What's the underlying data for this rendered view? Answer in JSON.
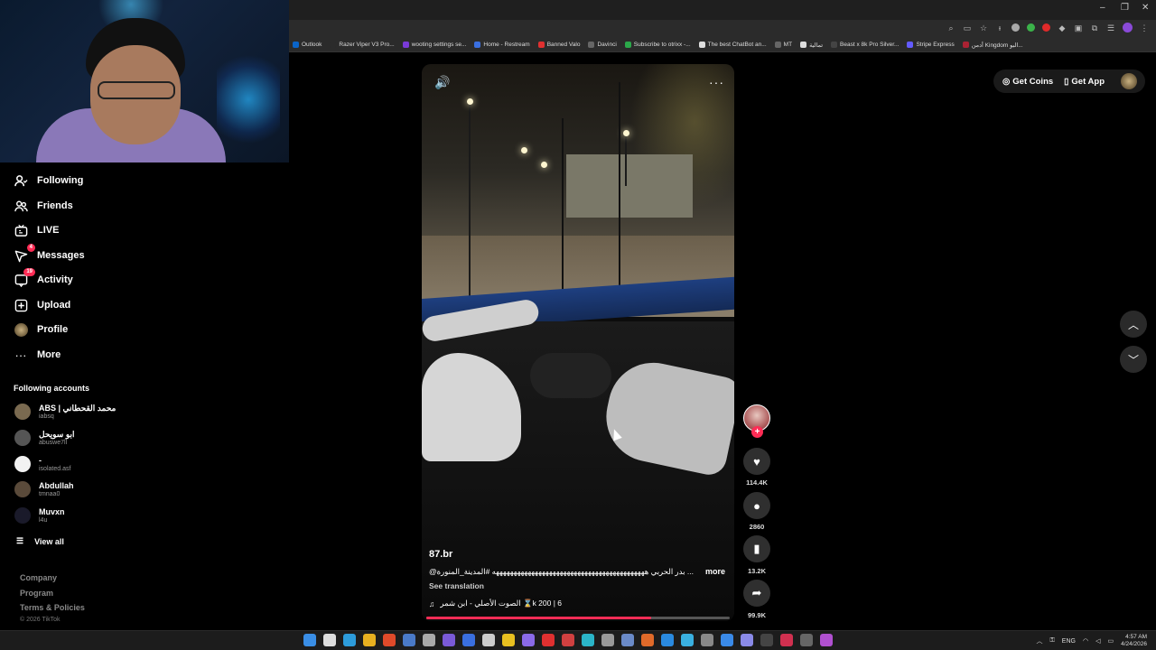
{
  "browser": {
    "bookmarks": [
      {
        "label": "Outlook",
        "color": "#0a64c8"
      },
      {
        "label": "Razer Viper V3 Pro...",
        "color": "#2b2b2b"
      },
      {
        "label": "wooting settings se...",
        "color": "#7a3ad8"
      },
      {
        "label": "Home - Restream",
        "color": "#3a6fe0"
      },
      {
        "label": "Banned Valo",
        "color": "#e03030"
      },
      {
        "label": "Davinci",
        "color": "#666666"
      },
      {
        "label": "Subscribe to otrixx -...",
        "color": "#2ba84a"
      },
      {
        "label": "The best ChatBot an...",
        "color": "#dddddd"
      },
      {
        "label": "MT",
        "color": "#666666"
      },
      {
        "label": "تمالية",
        "color": "#dddddd"
      },
      {
        "label": "Beast x 8k Pro Silver...",
        "color": "#444444"
      },
      {
        "label": "Stripe Express",
        "color": "#635bff"
      },
      {
        "label": "أدمن Kingdom البو...",
        "color": "#aa2233"
      }
    ]
  },
  "sidebar": {
    "nav": [
      {
        "label": "Following",
        "icon": "user-follow-icon"
      },
      {
        "label": "Friends",
        "icon": "friends-icon"
      },
      {
        "label": "LIVE",
        "icon": "live-icon"
      },
      {
        "label": "Messages",
        "icon": "messages-icon",
        "badge": "4"
      },
      {
        "label": "Activity",
        "icon": "activity-icon",
        "badge": "19"
      },
      {
        "label": "Upload",
        "icon": "upload-icon"
      },
      {
        "label": "Profile",
        "icon": "profile-avatar"
      },
      {
        "label": "More",
        "icon": "more-icon"
      }
    ],
    "following_title": "Following accounts",
    "accounts": [
      {
        "name": "ABS | محمد القحطاني",
        "handle": "iabsq",
        "color": "#7a6a50"
      },
      {
        "name": "ابو سويحل",
        "handle": "abuswe7ll",
        "color": "#555555"
      },
      {
        "name": "-",
        "handle": "isolated.asf",
        "color": "#f2f2f2"
      },
      {
        "name": "Abdullah",
        "handle": "tmnaa0",
        "color": "#5a4a3a"
      },
      {
        "name": "Muvxn",
        "handle": "l4u",
        "color": "#1a1a2a"
      }
    ],
    "view_all": "View all",
    "footer": [
      "Company",
      "Program",
      "Terms & Policies"
    ],
    "copyright": "© 2026 TikTok"
  },
  "video": {
    "author": "87.br",
    "caption": "@بدر الحربي هههههههههههههههههههههههههههههههههههههههههههه #المدينة_المنورة ...",
    "more": "more",
    "see_translation": "See translation",
    "music": "الصوت الأصلي - ابن شمر ⌛k 200 | 6",
    "progress_pct": 74
  },
  "actions": {
    "likes": "114.4K",
    "comments": "2860",
    "saves": "13.2K",
    "shares": "99.9K"
  },
  "topright": {
    "get_coins": "Get Coins",
    "get_app": "Get App"
  },
  "taskbar": {
    "lang": "ENG",
    "time": "4:57 AM",
    "date": "4/24/2026"
  }
}
